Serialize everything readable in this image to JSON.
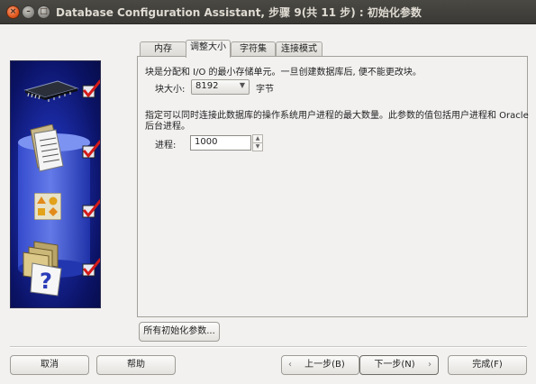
{
  "window": {
    "title": "Database Configuration Assistant, 步骤 9(共 11 步) : 初始化参数"
  },
  "tabs": [
    {
      "label": "内存",
      "active": false
    },
    {
      "label": "调整大小",
      "active": true
    },
    {
      "label": "字符集",
      "active": false
    },
    {
      "label": "连接模式",
      "active": false
    }
  ],
  "sizing": {
    "block_desc": "块是分配和 I/O 的最小存储单元。一旦创建数据库后, 便不能更改块。",
    "block_size_label": "块大小:",
    "block_size_value": "8192",
    "block_unit": "字节",
    "process_desc_line1": "指定可以同时连接此数据库的操作系统用户进程的最大数量。此参数的值包括用户进程和 Oracle",
    "process_desc_line2": "后台进程。",
    "process_label": "进程:",
    "process_value": "1000"
  },
  "all_params_button": "所有初始化参数...",
  "footer": {
    "cancel": "取消",
    "help": "帮助",
    "back": "上一步(B)",
    "next": "下一步(N)",
    "finish": "完成(F)"
  },
  "side_steps": [
    {
      "icon": "memory-chip-icon",
      "checked": true
    },
    {
      "icon": "documents-icon",
      "checked": true
    },
    {
      "icon": "shapes-icon",
      "checked": true
    },
    {
      "icon": "folders-help-icon",
      "checked": true
    }
  ]
}
